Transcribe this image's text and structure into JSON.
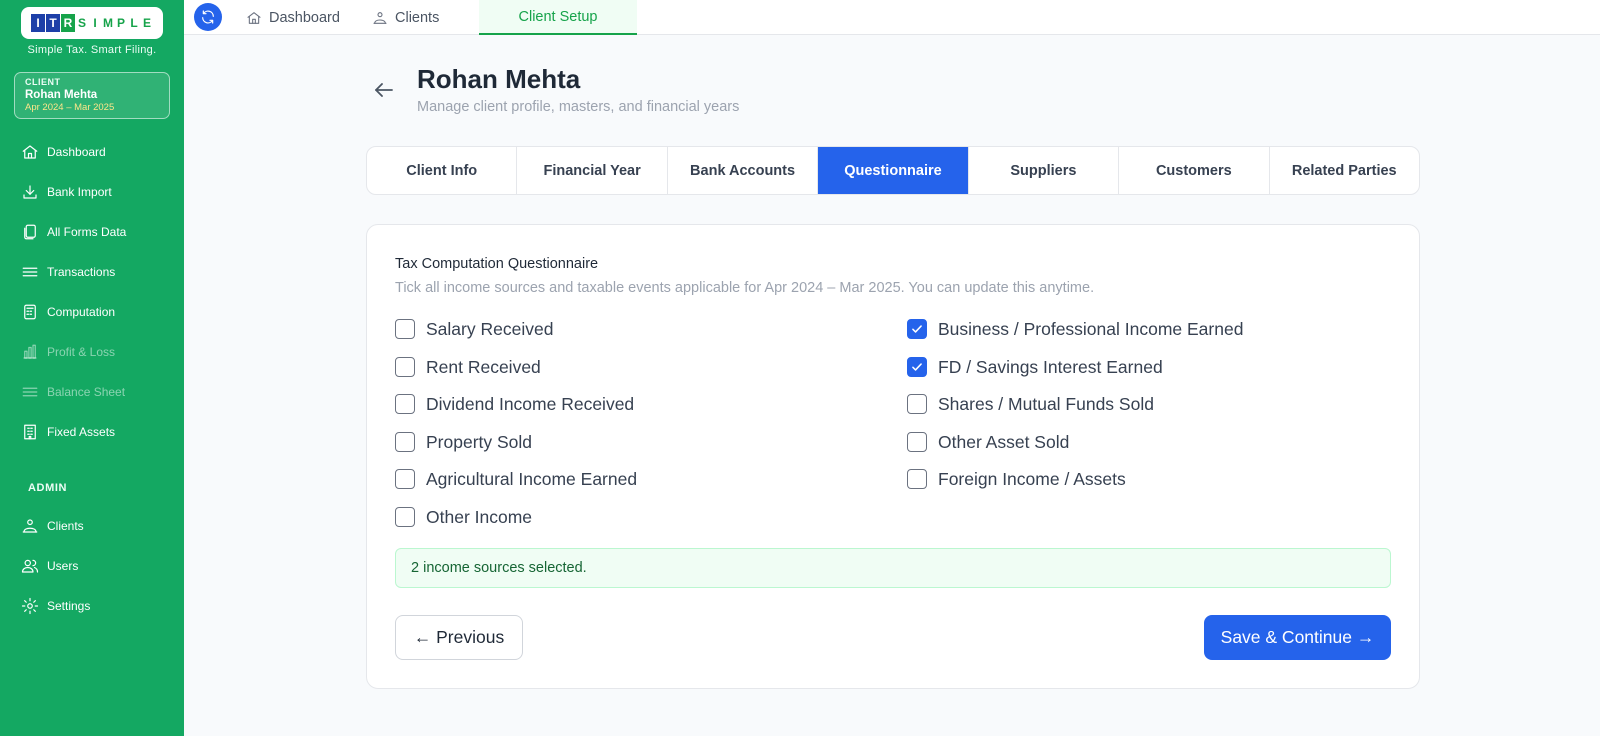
{
  "sidebar": {
    "logo_letters": [
      "I",
      "T",
      "R",
      "S",
      "I",
      "M",
      "P",
      "L",
      "E"
    ],
    "tagline": "Simple Tax. Smart Filing.",
    "client_card": {
      "label": "CLIENT",
      "name": "Rohan Mehta",
      "period": "Apr 2024 – Mar 2025"
    },
    "nav_items": [
      {
        "label": "Dashboard",
        "icon": "home-icon"
      },
      {
        "label": "Bank Import",
        "icon": "download-icon"
      },
      {
        "label": "All Forms Data",
        "icon": "files-icon"
      },
      {
        "label": "Transactions",
        "icon": "list-icon"
      },
      {
        "label": "Computation",
        "icon": "calculator-icon"
      },
      {
        "label": "Profit & Loss",
        "icon": "bar-chart-icon"
      },
      {
        "label": "Balance Sheet",
        "icon": "list-icon"
      },
      {
        "label": "Fixed Assets",
        "icon": "building-icon"
      }
    ],
    "admin_label": "ADMIN",
    "admin_items": [
      {
        "label": "Clients",
        "icon": "clients-icon"
      },
      {
        "label": "Users",
        "icon": "users-icon"
      },
      {
        "label": "Settings",
        "icon": "gear-icon"
      }
    ]
  },
  "topbar": {
    "tabs": [
      {
        "label": "Dashboard",
        "icon": "home-icon"
      },
      {
        "label": "Clients",
        "icon": "clients-icon"
      },
      {
        "label": "Client Setup"
      }
    ],
    "active_tab": "Client Setup"
  },
  "header": {
    "title": "Rohan Mehta",
    "subtitle": "Manage client profile, masters, and financial years"
  },
  "tabs": {
    "items": [
      "Client Info",
      "Financial Year",
      "Bank Accounts",
      "Questionnaire",
      "Suppliers",
      "Customers",
      "Related Parties"
    ],
    "active": "Questionnaire"
  },
  "questionnaire": {
    "title": "Tax Computation Questionnaire",
    "description": "Tick all income sources and taxable events applicable for Apr 2024 – Mar 2025. You can update this anytime.",
    "left_items": [
      {
        "label": "Salary Received",
        "checked": false
      },
      {
        "label": "Rent Received",
        "checked": false
      },
      {
        "label": "Dividend Income Received",
        "checked": false
      },
      {
        "label": "Property Sold",
        "checked": false
      },
      {
        "label": "Agricultural Income Earned",
        "checked": false
      },
      {
        "label": "Other Income",
        "checked": false
      }
    ],
    "right_items": [
      {
        "label": "Business / Professional Income Earned",
        "checked": true
      },
      {
        "label": "FD / Savings Interest Earned",
        "checked": true
      },
      {
        "label": "Shares / Mutual Funds Sold",
        "checked": false
      },
      {
        "label": "Other Asset Sold",
        "checked": false
      },
      {
        "label": "Foreign Income / Assets",
        "checked": false
      }
    ],
    "status": "2 income sources selected.",
    "previous_label": "← Previous",
    "save_label": "Save & Continue →"
  },
  "colors": {
    "sidebar_green": "#14a862",
    "primary_blue": "#2563eb",
    "active_tab_green": "#16a34a"
  }
}
